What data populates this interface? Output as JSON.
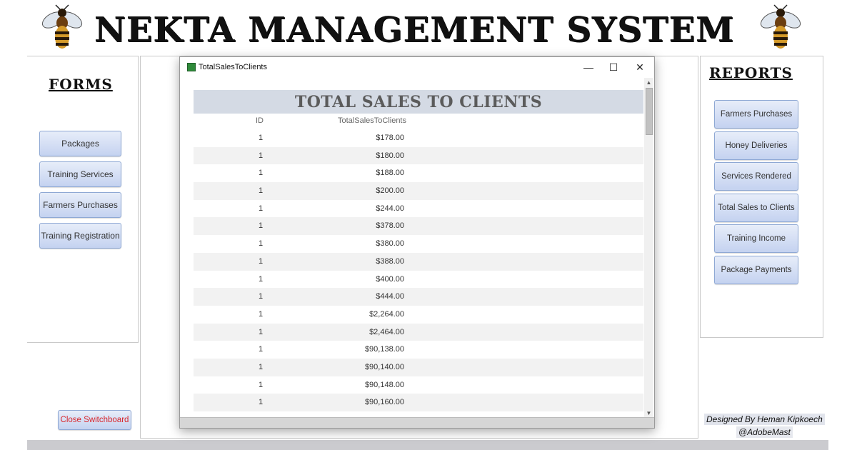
{
  "app": {
    "title": "NEKTA MANAGEMENT SYSTEM"
  },
  "icons": {
    "left_logo": "bee-icon",
    "right_logo": "bee-icon"
  },
  "forms": {
    "title": "FORMS",
    "buttons": [
      "Packages",
      "Training Services",
      "Farmers Purchases",
      "Training Registration"
    ]
  },
  "reports": {
    "title": "REPORTS",
    "buttons": [
      "Farmers Purchases",
      "Honey Deliveries",
      "Services Rendered",
      "Total Sales to Clients",
      "Training Income",
      "Package Payments"
    ]
  },
  "close_button": "Close Switchboard",
  "credits": {
    "line1": "Designed By Heman Kipkoech",
    "line2": "@AdobeMast"
  },
  "window": {
    "title": "TotalSalesToClients",
    "controls": {
      "minimize": "—",
      "maximize": "☐",
      "close": "✕"
    },
    "report_title": "TOTAL SALES TO CLIENTS",
    "columns": {
      "id": "ID",
      "total": "TotalSalesToClients"
    },
    "rows": [
      {
        "id": "1",
        "total": "$178.00"
      },
      {
        "id": "1",
        "total": "$180.00"
      },
      {
        "id": "1",
        "total": "$188.00"
      },
      {
        "id": "1",
        "total": "$200.00"
      },
      {
        "id": "1",
        "total": "$244.00"
      },
      {
        "id": "1",
        "total": "$378.00"
      },
      {
        "id": "1",
        "total": "$380.00"
      },
      {
        "id": "1",
        "total": "$388.00"
      },
      {
        "id": "1",
        "total": "$400.00"
      },
      {
        "id": "1",
        "total": "$444.00"
      },
      {
        "id": "1",
        "total": "$2,264.00"
      },
      {
        "id": "1",
        "total": "$2,464.00"
      },
      {
        "id": "1",
        "total": "$90,138.00"
      },
      {
        "id": "1",
        "total": "$90,140.00"
      },
      {
        "id": "1",
        "total": "$90,148.00"
      },
      {
        "id": "1",
        "total": "$90,160.00"
      }
    ]
  },
  "colors": {
    "button_border": "#8ea8d4",
    "button_fill": "#c4d2f0",
    "close_text": "#d8262c",
    "report_header_bg": "#d4dae4"
  }
}
